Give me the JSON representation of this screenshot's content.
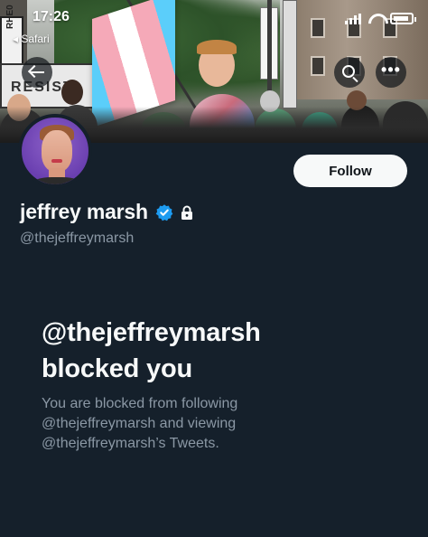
{
  "status_bar": {
    "time": "17:26",
    "back_app": "Safari",
    "icons": [
      "signal-icon",
      "wifi-icon",
      "battery-icon"
    ]
  },
  "header": {
    "back_icon": "arrow-left-icon",
    "search_icon": "search-icon",
    "more_icon": "more-icon",
    "more_glyph": "•••"
  },
  "banner": {
    "sign_text": "RHE0",
    "board_text": "RESIST"
  },
  "profile": {
    "display_name": "jeffrey marsh",
    "handle": "@thejeffreymarsh",
    "verified_icon": "verified-badge-icon",
    "protected_icon": "lock-icon",
    "follow_label": "Follow"
  },
  "blocked": {
    "title_line1": "@thejeffreymarsh",
    "title_line2": "blocked you",
    "description_line1": "You are blocked from following",
    "description_line2": "@thejeffreymarsh and viewing",
    "description_line3": "@thejeffreymarsh’s Tweets."
  },
  "colors": {
    "background": "#15202b",
    "primary_text": "#f7f9f9",
    "secondary_text": "#8b98a5",
    "verified_blue": "#1d9bf0",
    "follow_button_bg": "#f7f9f9"
  }
}
